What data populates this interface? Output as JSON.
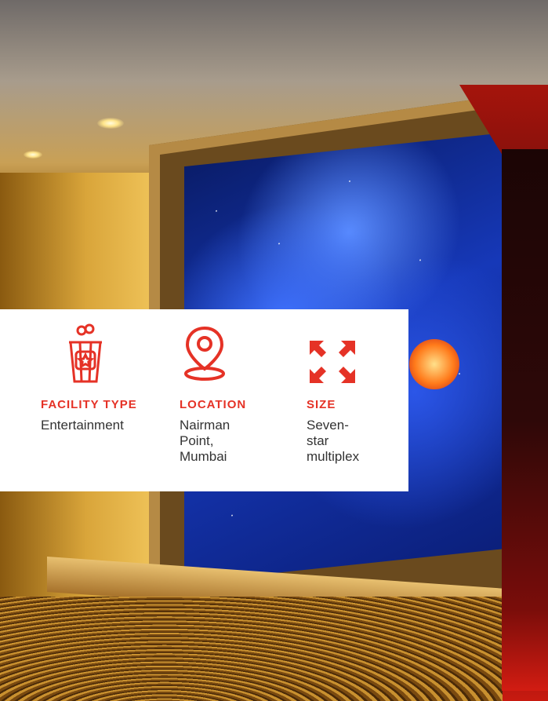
{
  "colors": {
    "accent": "#e53226",
    "text": "#333333",
    "card_background": "#ffffff"
  },
  "facts": [
    {
      "icon": "popcorn-icon",
      "label": "FACILITY TYPE",
      "value": "Entertainment"
    },
    {
      "icon": "location-pin-icon",
      "label": "LOCATION",
      "value_lines": [
        "Nairman Point,",
        "Mumbai"
      ]
    },
    {
      "icon": "expand-arrows-icon",
      "label": "SIZE",
      "value_lines": [
        "Seven-star",
        "multiplex"
      ]
    }
  ],
  "hero": {
    "image": "cinema-lobby-photo"
  }
}
